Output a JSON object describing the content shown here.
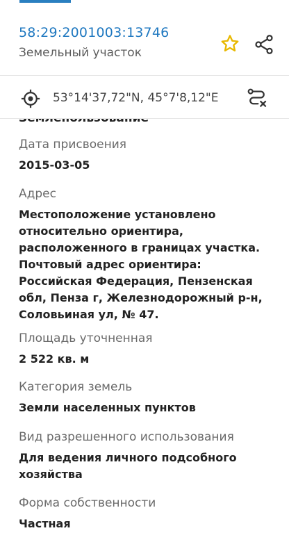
{
  "header": {
    "cadastral_number": "58:29:2001003:13746",
    "object_type": "Земельный участок",
    "favorite_icon": "star-outline-icon",
    "share_icon": "share-icon",
    "accent_color": "#1f78c0",
    "star_color": "#f2c200"
  },
  "coordinates": {
    "icon": "target-icon",
    "text": "53°14'37,72\"N, 45°7'8,12\"E",
    "route_icon": "route-icon"
  },
  "details": {
    "cut_value": "Землепользование",
    "fields": [
      {
        "label": "Дата присвоения",
        "value": "2015-03-05"
      },
      {
        "label": "Адрес",
        "value": "Местоположение установлено относительно ориентира, расположенного в границах участка. Почтовый адрес ориентира: Российская Федерация, Пензенская обл, Пенза г, Железнодорожный р-н, Соловьиная ул, № 47."
      },
      {
        "label": "Площадь уточненная",
        "value": "2 522 кв. м"
      },
      {
        "label": "Категория земель",
        "value": "Земли населенных пунктов"
      },
      {
        "label": "Вид разрешенного использования",
        "value": "Для ведения личного подсобного хозяйства"
      },
      {
        "label": "Форма собственности",
        "value": "Частная"
      }
    ]
  }
}
